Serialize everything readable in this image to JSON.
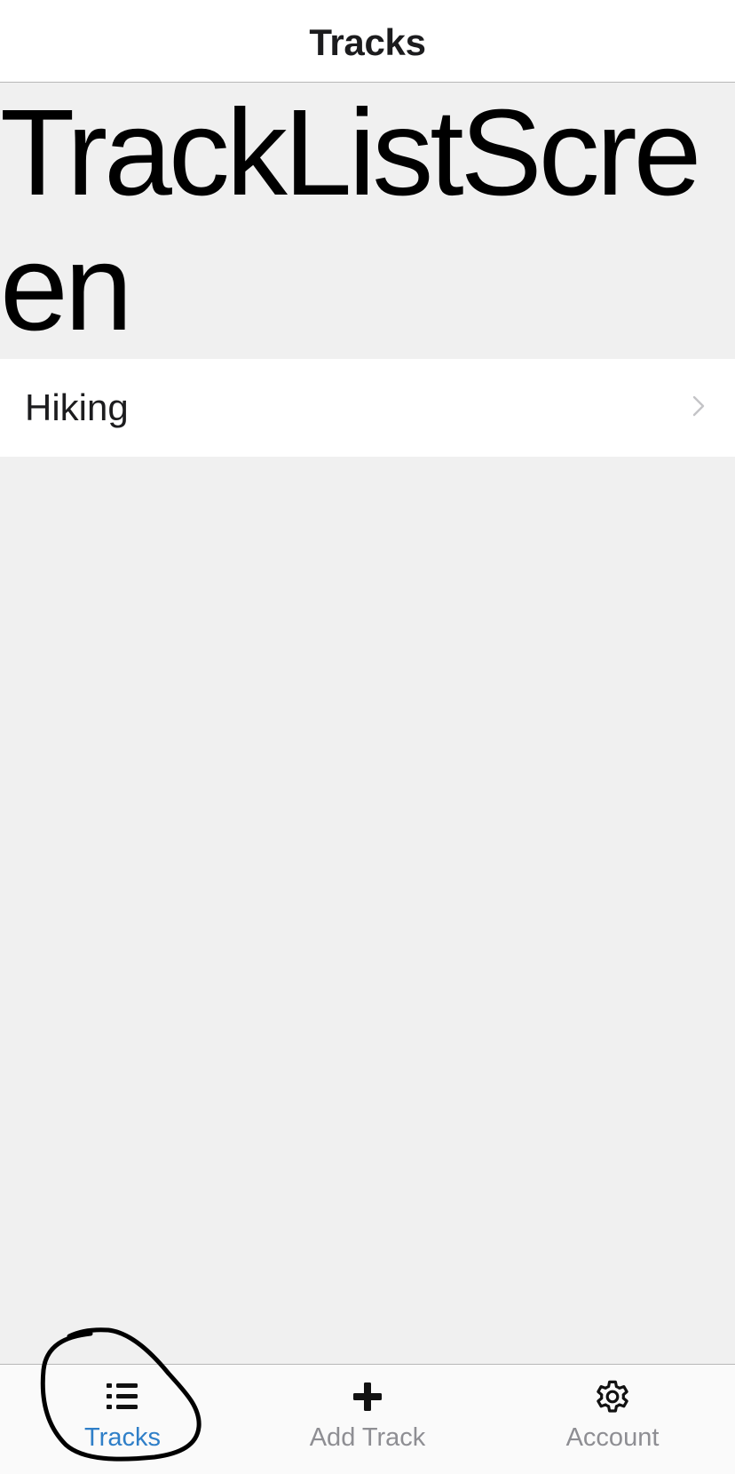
{
  "nav": {
    "title": "Tracks"
  },
  "screen": {
    "heading": "TrackListScreen"
  },
  "tracks": [
    {
      "label": "Hiking",
      "icon": "chevron-right-icon"
    }
  ],
  "tab_bar": {
    "tabs": [
      {
        "label": "Tracks",
        "icon": "list-icon",
        "active": true
      },
      {
        "label": "Add Track",
        "icon": "plus-icon",
        "active": false
      },
      {
        "label": "Account",
        "icon": "gear-icon",
        "active": false
      }
    ],
    "active_color": "#2f7fc8",
    "inactive_color": "#8e8e93"
  },
  "colors": {
    "background": "#f0f0f0",
    "surface": "#ffffff",
    "separator": "#b8b8b8",
    "annotation": "#000000"
  }
}
